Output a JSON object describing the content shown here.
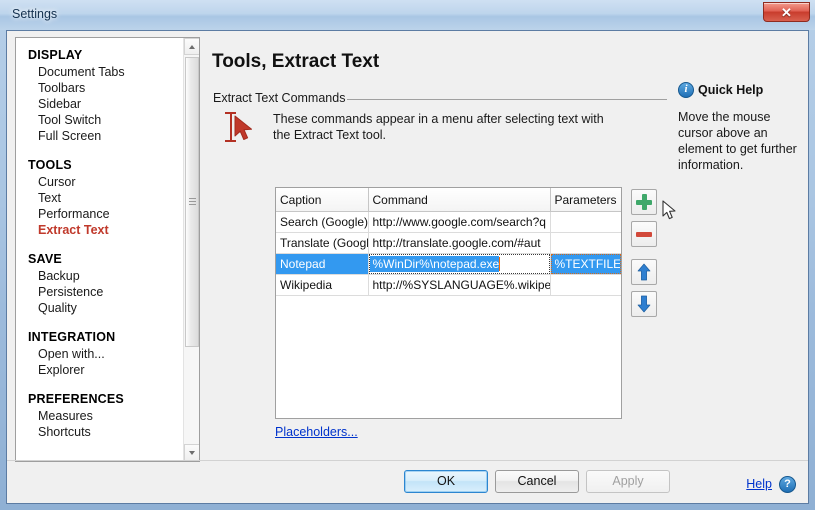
{
  "window": {
    "title": "Settings",
    "close_label": "✕"
  },
  "sidebar": {
    "groups": [
      {
        "name": "DISPLAY",
        "items": [
          {
            "label": "Document Tabs",
            "active": false
          },
          {
            "label": "Toolbars",
            "active": false
          },
          {
            "label": "Sidebar",
            "active": false
          },
          {
            "label": "Tool Switch",
            "active": false
          },
          {
            "label": "Full Screen",
            "active": false
          }
        ]
      },
      {
        "name": "TOOLS",
        "items": [
          {
            "label": "Cursor",
            "active": false
          },
          {
            "label": "Text",
            "active": false
          },
          {
            "label": "Performance",
            "active": false
          },
          {
            "label": "Extract Text",
            "active": true
          }
        ]
      },
      {
        "name": "SAVE",
        "items": [
          {
            "label": "Backup",
            "active": false
          },
          {
            "label": "Persistence",
            "active": false
          },
          {
            "label": "Quality",
            "active": false
          }
        ]
      },
      {
        "name": "INTEGRATION",
        "items": [
          {
            "label": "Open with...",
            "active": false
          },
          {
            "label": "Explorer",
            "active": false
          }
        ]
      },
      {
        "name": "PREFERENCES",
        "items": [
          {
            "label": "Measures",
            "active": false
          },
          {
            "label": "Shortcuts",
            "active": false
          }
        ]
      }
    ]
  },
  "main": {
    "page_title": "Tools, Extract Text",
    "group_label": "Extract Text Commands",
    "description": "These commands appear in a menu after selecting text with the Extract Text tool.",
    "table": {
      "columns": [
        "Caption",
        "Command",
        "Parameters"
      ],
      "rows": [
        {
          "caption": "Search (Google)",
          "command": "http://www.google.com/search?q",
          "parameters": "",
          "selected": false,
          "editing": false
        },
        {
          "caption": "Translate (Google)",
          "command": "http://translate.google.com/#aut",
          "parameters": "",
          "selected": false,
          "editing": false
        },
        {
          "caption": "Notepad",
          "command": "%WinDir%\\notepad.exe",
          "parameters": "%TEXTFILE%",
          "selected": true,
          "editing": true
        },
        {
          "caption": "Wikipedia",
          "command": "http://%SYSLANGUAGE%.wikiped",
          "parameters": "",
          "selected": false,
          "editing": false
        }
      ]
    },
    "placeholders_link": "Placeholders...",
    "side_buttons": [
      {
        "name": "add",
        "icon": "plus-icon"
      },
      {
        "name": "remove",
        "icon": "minus-icon"
      },
      {
        "name": "move-up",
        "icon": "arrow-up-icon"
      },
      {
        "name": "move-down",
        "icon": "arrow-down-icon"
      }
    ]
  },
  "quick_help": {
    "title": "Quick Help",
    "body": "Move the mouse cursor above an element to get further information."
  },
  "footer": {
    "ok": "OK",
    "cancel": "Cancel",
    "apply": "Apply",
    "help": "Help"
  },
  "colors": {
    "accent_selection": "#3399f0",
    "active_item": "#c0392b",
    "link": "#0033cc",
    "add_icon": "#3fa86a",
    "remove_icon": "#d2493a",
    "arrow_icon": "#2f7fd0",
    "caret": "#ff6a00"
  }
}
